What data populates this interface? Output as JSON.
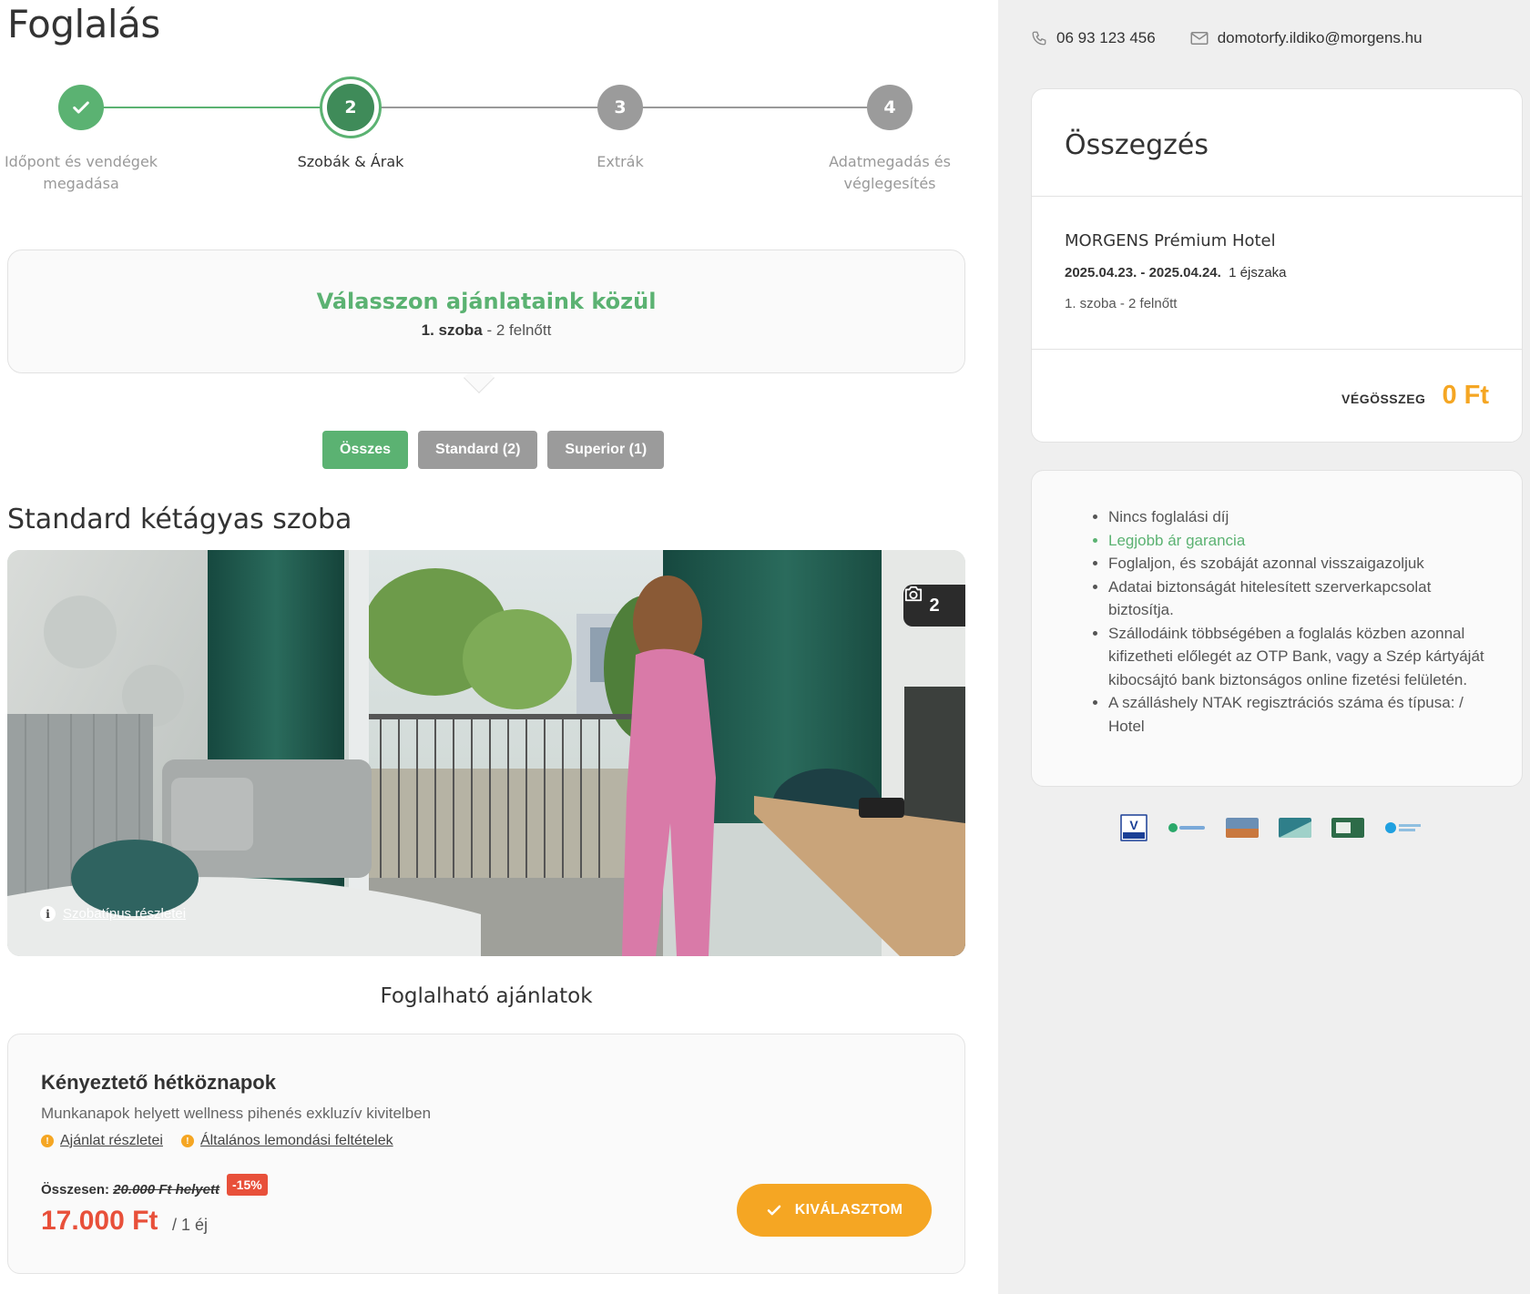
{
  "page": {
    "title": "Foglalás"
  },
  "stepper": {
    "steps": [
      {
        "number": "1",
        "label_line1": "Időpont és vendégek",
        "label_line2": "megadása",
        "state": "done"
      },
      {
        "number": "2",
        "label_line1": "Szobák & Árak",
        "label_line2": "",
        "state": "active"
      },
      {
        "number": "3",
        "label_line1": "Extrák",
        "label_line2": "",
        "state": "pending"
      },
      {
        "number": "4",
        "label_line1": "Adatmegadás és",
        "label_line2": "véglegesítés",
        "state": "pending"
      }
    ]
  },
  "offers": {
    "title": "Válasszon ajánlataink közül",
    "room_bold": "1. szoba",
    "room_rest": " - 2 felnőtt"
  },
  "filters": [
    {
      "label": "Összes",
      "active": true
    },
    {
      "label": "Standard (2)",
      "active": false
    },
    {
      "label": "Superior (1)",
      "active": false
    }
  ],
  "room": {
    "title": "Standard kétágyas szoba",
    "photo_count": "2",
    "details_link": "Szobatípus részletei"
  },
  "available": {
    "title": "Foglalható ajánlatok"
  },
  "package": {
    "title": "Kényeztető hétköznapok",
    "description": "Munkanapok helyett wellness pihenés exkluzív kivitelben",
    "link_details": "Ajánlat részletei",
    "link_cancel": "Általános lemondási feltételek",
    "total_label": "Összesen:",
    "old_price": "20.000 Ft helyett",
    "discount": "-15%",
    "price": "17.000 Ft",
    "per": "/ 1 éj",
    "select_label": "KIVÁLASZTOM"
  },
  "contact": {
    "phone": "06 93 123 456",
    "email": "domotorfy.ildiko@morgens.hu"
  },
  "summary": {
    "title": "Összegzés",
    "hotel": "MORGENS Prémium Hotel",
    "dates": "2025.04.23. - 2025.04.24.",
    "nights": "1 éjszaka",
    "rooms": "1. szoba - 2 felnőtt",
    "total_label": "VÉGÖSSZEG",
    "total_value": "0 Ft"
  },
  "info": {
    "items": [
      "Nincs foglalási díj",
      "Legjobb ár garancia",
      "Foglaljon, és szobáját azonnal visszaigazoljuk",
      "Adatai biztonságát hitelesített szerverkapcsolat biztosítja.",
      "Szállodáink többségében a foglalás közben azonnal kifizetheti előlegét az OTP Bank, vagy a Szép kártyáját kibocsájtó bank biztonságos online fizetési felületén.",
      "A szálláshely NTAK regisztrációs száma és típusa: / Hotel"
    ]
  },
  "payment_logos": [
    "vpay-icon",
    "simplepay-icon",
    "szep-card-icon",
    "card-icon",
    "otp-icon",
    "barion-icon"
  ],
  "colors": {
    "green": "#5bb272",
    "orange": "#f5a623",
    "red": "#e8503a",
    "gray": "#9b9b9b"
  }
}
